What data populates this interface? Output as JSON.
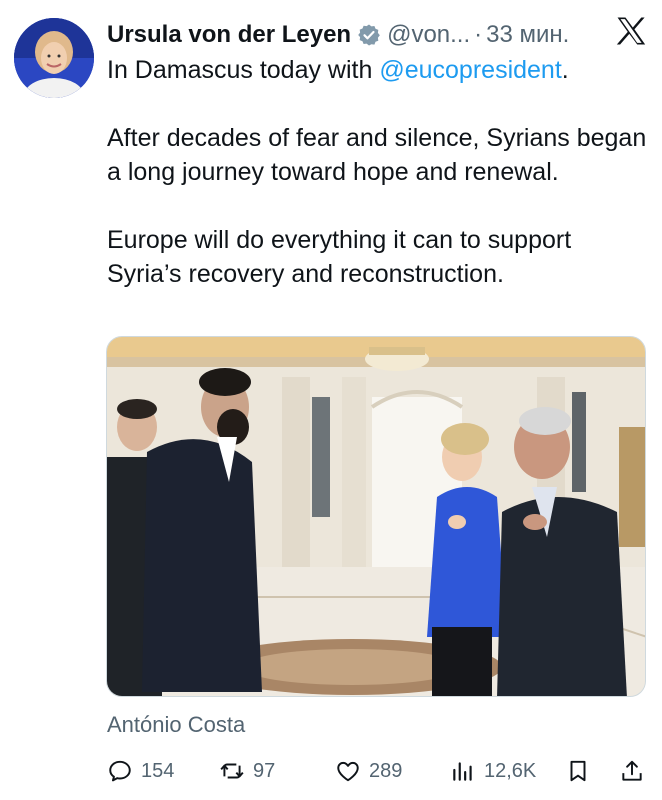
{
  "author": {
    "display_name": "Ursula von der Leyen",
    "handle": "@von...",
    "separator": "·",
    "time_ago": "33 мин.",
    "avatar_icon": "avatar-photo",
    "verified_icon": "verified-badge-icon"
  },
  "platform_icon": "x-logo-icon",
  "tweet": {
    "line1_prefix": "In Damascus today with ",
    "line1_mention": "@eucopresident",
    "line1_suffix": ".",
    "para2": "After decades of fear and silence, Syrians began a long journey toward hope and renewal.",
    "para3": "Europe will do everything it can to support Syria’s recovery and reconstruction."
  },
  "media": {
    "alt_icon": "photo-of-meeting-in-palace-hall"
  },
  "tagged": "António Costa",
  "actions": {
    "replies": "154",
    "reposts": "97",
    "likes": "289",
    "views": "12,6K"
  },
  "colors": {
    "text": "#0f1419",
    "secondary": "#536471",
    "link": "#1d9bf0",
    "verified": "#829aab"
  }
}
